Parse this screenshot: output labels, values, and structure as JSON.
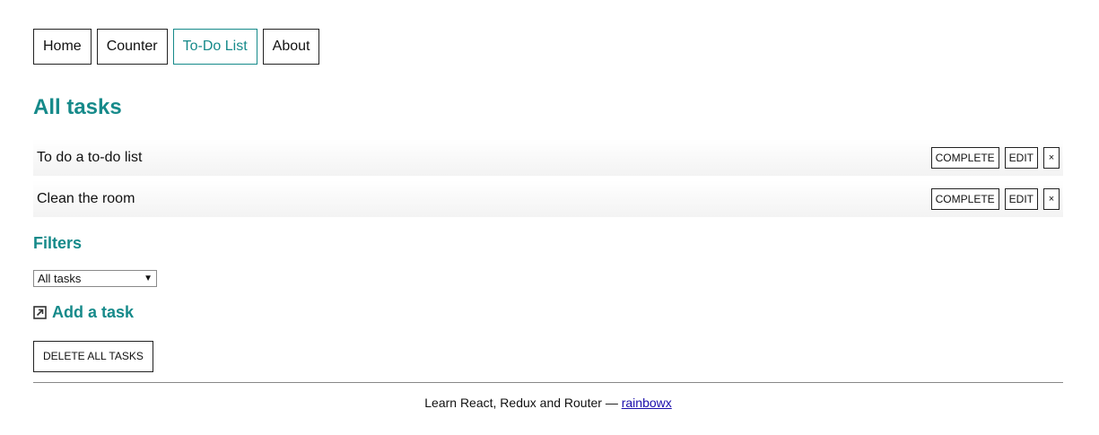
{
  "nav": {
    "items": [
      {
        "label": "Home"
      },
      {
        "label": "Counter"
      },
      {
        "label": "To-Do List",
        "active": true
      },
      {
        "label": "About"
      }
    ]
  },
  "main": {
    "title": "All tasks",
    "tasks": [
      {
        "title": "To do a to-do list"
      },
      {
        "title": "Clean the room"
      }
    ],
    "task_actions": {
      "complete_label": "COMPLETE",
      "edit_label": "EDIT",
      "delete_label": "×"
    }
  },
  "filters": {
    "title": "Filters",
    "selected": "All tasks"
  },
  "add_task": {
    "label": "Add a task",
    "icon": "external-link-icon"
  },
  "delete_all": {
    "label": "DELETE ALL TASKS"
  },
  "footer": {
    "text": "Learn React, Redux and Router — ",
    "link_label": "rainbowx"
  },
  "colors": {
    "accent": "#168a8a",
    "link": "#1a0dab",
    "border": "#222222"
  }
}
